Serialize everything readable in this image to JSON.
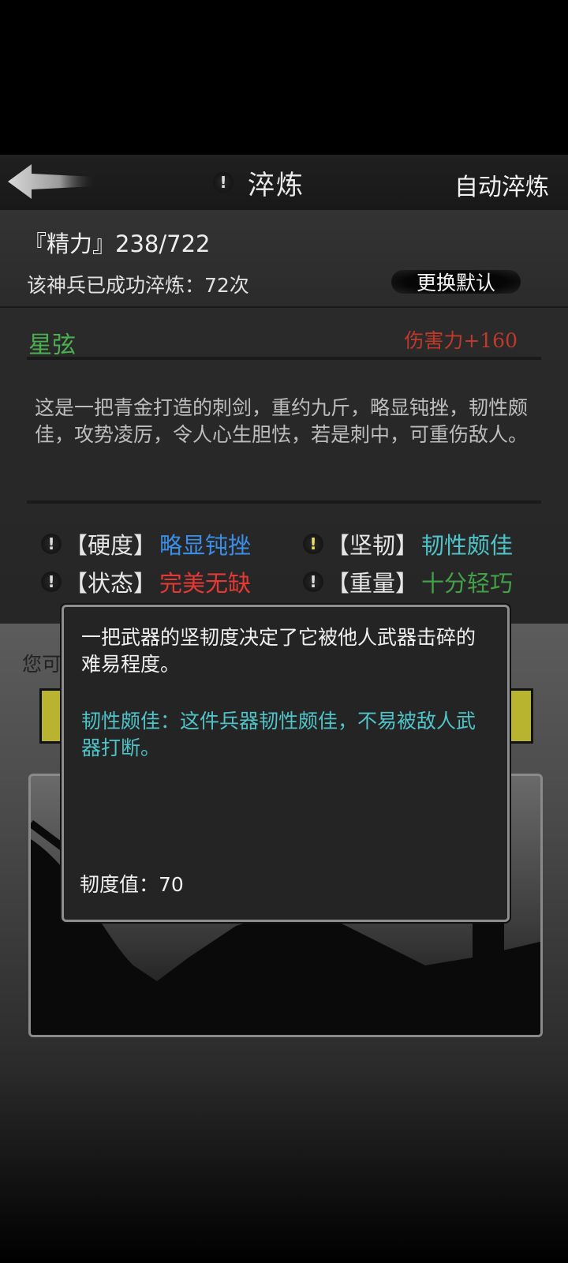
{
  "header": {
    "title": "淬炼",
    "auto_button": "自动淬炼"
  },
  "stats": {
    "energy": "『精力』238/722",
    "refine_count": "该神兵已成功淬炼：72次",
    "change_default": "更换默认"
  },
  "weapon": {
    "name": "星弦",
    "damage": "伤害力+160",
    "description": "这是一把青金打造的刺剑，重约九斤，略显钝挫，韧性颇佳，攻势凌厉，令人心生胆怯，若是刺中，可重伤敌人。"
  },
  "attributes": [
    {
      "label": "【硬度】",
      "value": "略显钝挫",
      "color": "#3b8ee8"
    },
    {
      "label": "【坚韧】",
      "value": "韧性颇佳",
      "color": "#4fc3c8"
    },
    {
      "label": "【状态】",
      "value": "完美无缺",
      "color": "#e53935"
    },
    {
      "label": "【重量】",
      "value": "十分轻巧",
      "color": "#43a047"
    }
  ],
  "hint_text": "您可",
  "tooltip": {
    "main": "一把武器的坚韧度决定了它被他人武器击碎的难易程度。",
    "detail": "韧性颇佳：这件兵器韧性颇佳，不易被敌人武器打断。",
    "value": "韧度值：70"
  },
  "icons": {
    "back": "back-arrow-icon",
    "info": "exclamation-icon"
  }
}
